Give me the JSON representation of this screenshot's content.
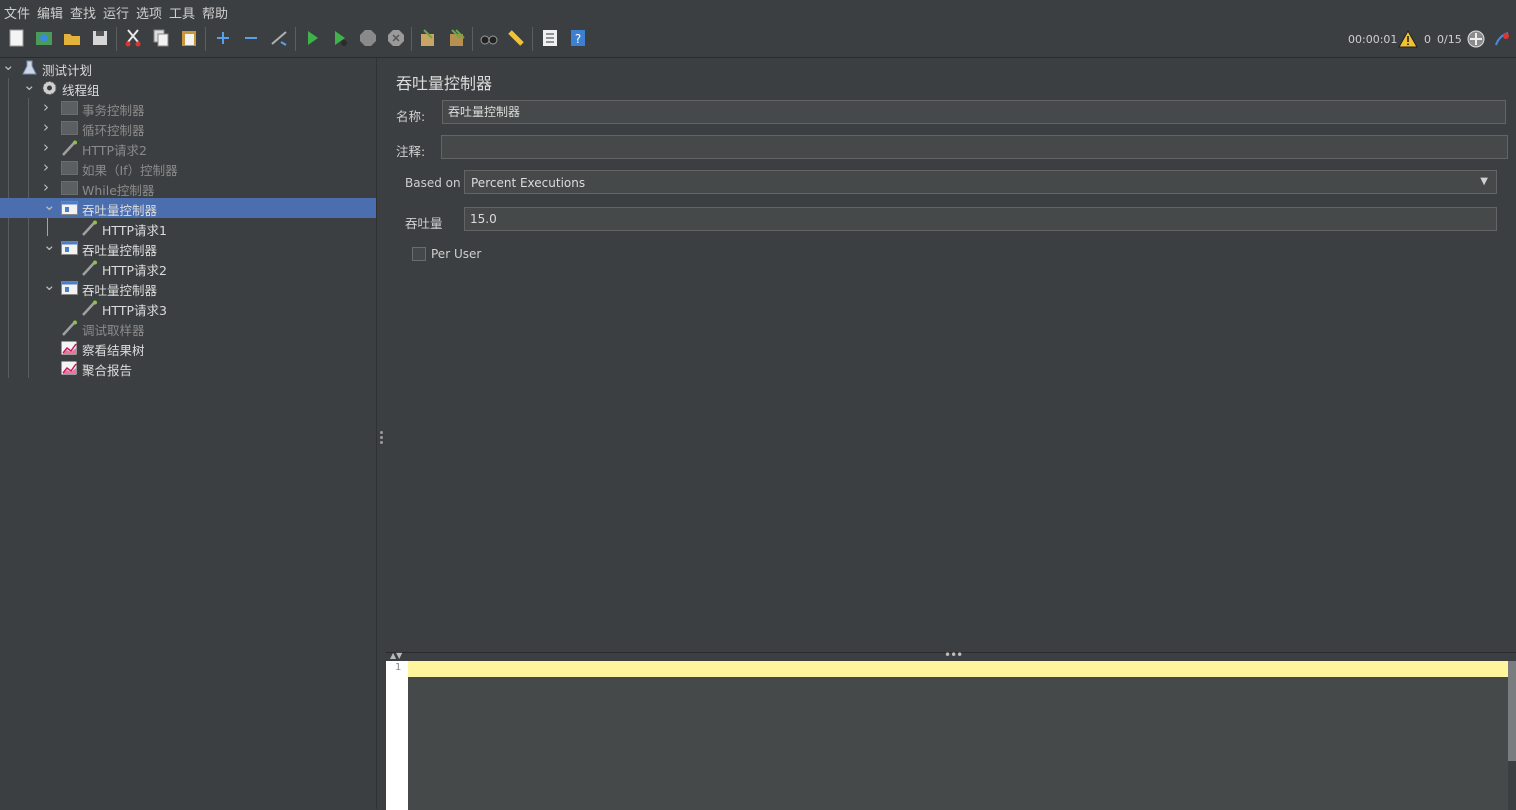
{
  "menu": [
    "文件",
    "编辑",
    "查找",
    "运行",
    "选项",
    "工具",
    "帮助"
  ],
  "toolbar": {
    "icons": [
      "new-icon",
      "templates-icon",
      "open-icon",
      "save-icon",
      "cut-icon",
      "copy-icon",
      "paste-icon",
      "expand-icon",
      "collapse-icon",
      "toggle-icon",
      "start-icon",
      "start-no-pause-icon",
      "stop-icon",
      "shutdown-icon",
      "clear-icon",
      "clear-all-icon",
      "search-icon",
      "reset-search-icon",
      "function-helper-icon",
      "help-icon"
    ]
  },
  "status": {
    "elapsed": "00:00:01",
    "warnings": "0",
    "threads": "0/15"
  },
  "tree": [
    {
      "label": "测试计划",
      "indent": 0,
      "expand": "open",
      "icon": "flask-icon",
      "dim": false
    },
    {
      "label": "线程组",
      "indent": 1,
      "expand": "open",
      "icon": "gear-icon",
      "dim": false
    },
    {
      "label": "事务控制器",
      "indent": 2,
      "expand": "closed",
      "icon": "controller-icon",
      "dim": true
    },
    {
      "label": "循环控制器",
      "indent": 2,
      "expand": "closed",
      "icon": "controller-icon",
      "dim": true
    },
    {
      "label": "HTTP请求2",
      "indent": 2,
      "expand": "closed",
      "icon": "pipette-icon",
      "dim": true
    },
    {
      "label": "如果（If）控制器",
      "indent": 2,
      "expand": "closed",
      "icon": "controller-icon",
      "dim": true
    },
    {
      "label": "While控制器",
      "indent": 2,
      "expand": "closed",
      "icon": "controller-icon",
      "dim": true
    },
    {
      "label": "吞吐量控制器",
      "indent": 2,
      "expand": "open",
      "icon": "throughput-icon",
      "dim": false,
      "selected": true
    },
    {
      "label": "HTTP请求1",
      "indent": 3,
      "expand": "none",
      "icon": "pipette-icon",
      "dim": false
    },
    {
      "label": "吞吐量控制器",
      "indent": 2,
      "expand": "open",
      "icon": "throughput-icon",
      "dim": false
    },
    {
      "label": "HTTP请求2",
      "indent": 3,
      "expand": "none",
      "icon": "pipette-icon",
      "dim": false
    },
    {
      "label": "吞吐量控制器",
      "indent": 2,
      "expand": "open",
      "icon": "throughput-icon",
      "dim": false
    },
    {
      "label": "HTTP请求3",
      "indent": 3,
      "expand": "none",
      "icon": "pipette-icon",
      "dim": false
    },
    {
      "label": "调试取样器",
      "indent": 2,
      "expand": "none",
      "icon": "pipette-icon",
      "dim": true
    },
    {
      "label": "察看结果树",
      "indent": 2,
      "expand": "none",
      "icon": "chart-icon",
      "dim": false
    },
    {
      "label": "聚合报告",
      "indent": 2,
      "expand": "none",
      "icon": "chart-icon",
      "dim": false
    }
  ],
  "panel": {
    "title": "吞吐量控制器",
    "name_label": "名称:",
    "name_value": "吞吐量控制器",
    "comment_label": "注释:",
    "comment_value": "",
    "based_on_label": "Based on",
    "based_on_value": "Percent Executions",
    "throughput_label": "吞吐量",
    "throughput_value": "15.0",
    "per_user_label": "Per User"
  },
  "editor": {
    "line_number": "1"
  },
  "colors": {
    "selection": "#4b6eaf",
    "background": "#3c3f41",
    "current_line": "#fff59c"
  }
}
